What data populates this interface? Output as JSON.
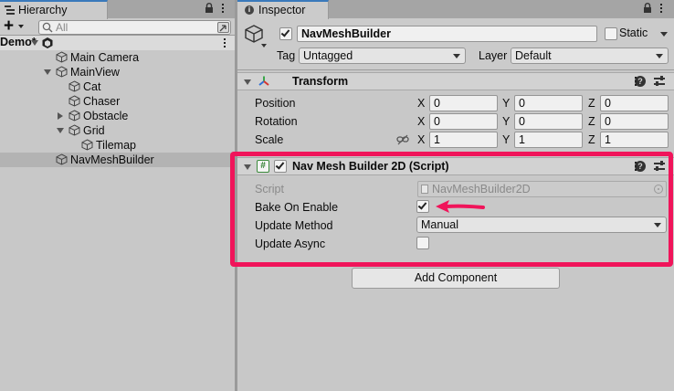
{
  "hierarchy": {
    "tab_label": "Hierarchy",
    "search_placeholder": "All",
    "scene_name": "Demo*",
    "items": [
      {
        "label": "Main Camera"
      },
      {
        "label": "MainView"
      },
      {
        "label": "Cat"
      },
      {
        "label": "Chaser"
      },
      {
        "label": "Obstacle"
      },
      {
        "label": "Grid"
      },
      {
        "label": "Tilemap"
      },
      {
        "label": "NavMeshBuilder"
      }
    ]
  },
  "inspector": {
    "tab_label": "Inspector",
    "object_name": "NavMeshBuilder",
    "static_label": "Static",
    "tag_label": "Tag",
    "tag_value": "Untagged",
    "layer_label": "Layer",
    "layer_value": "Default",
    "transform": {
      "title": "Transform",
      "position_label": "Position",
      "rotation_label": "Rotation",
      "scale_label": "Scale",
      "axis_x": "X",
      "axis_y": "Y",
      "axis_z": "Z",
      "position": {
        "x": "0",
        "y": "0",
        "z": "0"
      },
      "rotation": {
        "x": "0",
        "y": "0",
        "z": "0"
      },
      "scale": {
        "x": "1",
        "y": "1",
        "z": "1"
      }
    },
    "script_component": {
      "hash_icon": "#",
      "title": "Nav Mesh Builder 2D (Script)",
      "script_label": "Script",
      "script_value": "NavMeshBuilder2D",
      "bake_on_enable_label": "Bake On Enable",
      "bake_on_enable": true,
      "update_method_label": "Update Method",
      "update_method_value": "Manual",
      "update_async_label": "Update Async",
      "update_async": false
    },
    "add_component_label": "Add Component"
  },
  "colors": {
    "highlight": "#f0145a",
    "tab_accent": "#3a79bb"
  },
  "icons": [
    "lock-icon",
    "kebab-menu-icon",
    "search-icon",
    "gameobject-cube-icon",
    "unity-scene-icon",
    "transform-axes-icon",
    "help-icon",
    "preset-sliders-icon",
    "script-hash-icon",
    "constrain-proportions-icon",
    "object-picker-icon"
  ]
}
